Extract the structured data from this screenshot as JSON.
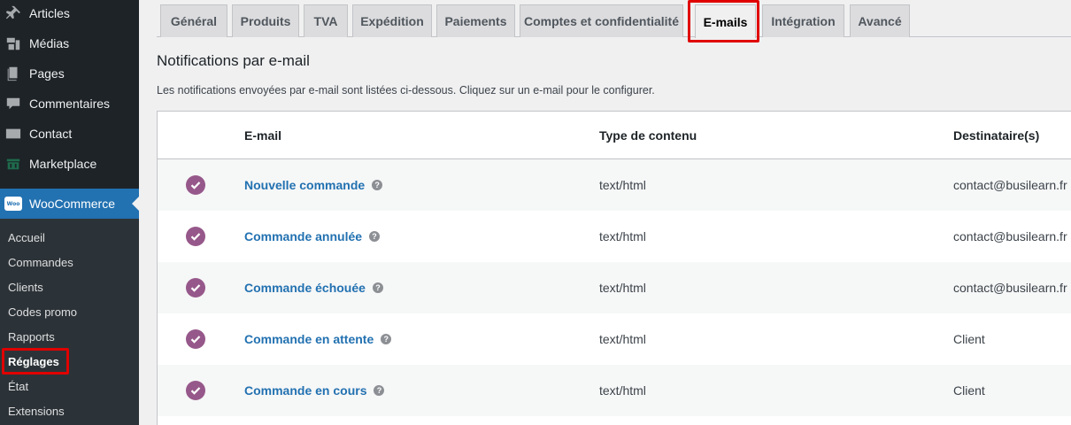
{
  "sidebar": {
    "menu": [
      {
        "label": "Articles",
        "icon": "pin-icon"
      },
      {
        "label": "Médias",
        "icon": "media-icon"
      },
      {
        "label": "Pages",
        "icon": "pages-icon"
      },
      {
        "label": "Commentaires",
        "icon": "comment-icon"
      },
      {
        "label": "Contact",
        "icon": "mail-icon"
      },
      {
        "label": "Marketplace",
        "icon": "marketplace-icon"
      }
    ],
    "woocommerce": {
      "label": "WooCommerce",
      "badge": "Woo"
    },
    "submenu": [
      {
        "label": "Accueil"
      },
      {
        "label": "Commandes"
      },
      {
        "label": "Clients"
      },
      {
        "label": "Codes promo"
      },
      {
        "label": "Rapports"
      },
      {
        "label": "Réglages",
        "active": true
      },
      {
        "label": "État"
      },
      {
        "label": "Extensions"
      }
    ]
  },
  "tabs": [
    {
      "label": "Général"
    },
    {
      "label": "Produits"
    },
    {
      "label": "TVA"
    },
    {
      "label": "Expédition"
    },
    {
      "label": "Paiements"
    },
    {
      "label": "Comptes et confidentialité"
    },
    {
      "label": "E-mails",
      "active": true
    },
    {
      "label": "Intégration"
    },
    {
      "label": "Avancé"
    }
  ],
  "page": {
    "title": "Notifications par e-mail",
    "description": "Les notifications envoyées par e-mail sont listées ci-dessous. Cliquez sur un e-mail pour le configurer."
  },
  "table": {
    "headers": {
      "email": "E-mail",
      "content_type": "Type de contenu",
      "recipients": "Destinataire(s)"
    },
    "rows": [
      {
        "name": "Nouvelle commande",
        "type": "text/html",
        "recipient": "contact@busilearn.fr"
      },
      {
        "name": "Commande annulée",
        "type": "text/html",
        "recipient": "contact@busilearn.fr"
      },
      {
        "name": "Commande échouée",
        "type": "text/html",
        "recipient": "contact@busilearn.fr"
      },
      {
        "name": "Commande en attente",
        "type": "text/html",
        "recipient": "Client"
      },
      {
        "name": "Commande en cours",
        "type": "text/html",
        "recipient": "Client"
      }
    ],
    "help_glyph": "?"
  },
  "colors": {
    "accent": "#2271b1",
    "check": "#96588a",
    "highlight": "#e00000"
  }
}
